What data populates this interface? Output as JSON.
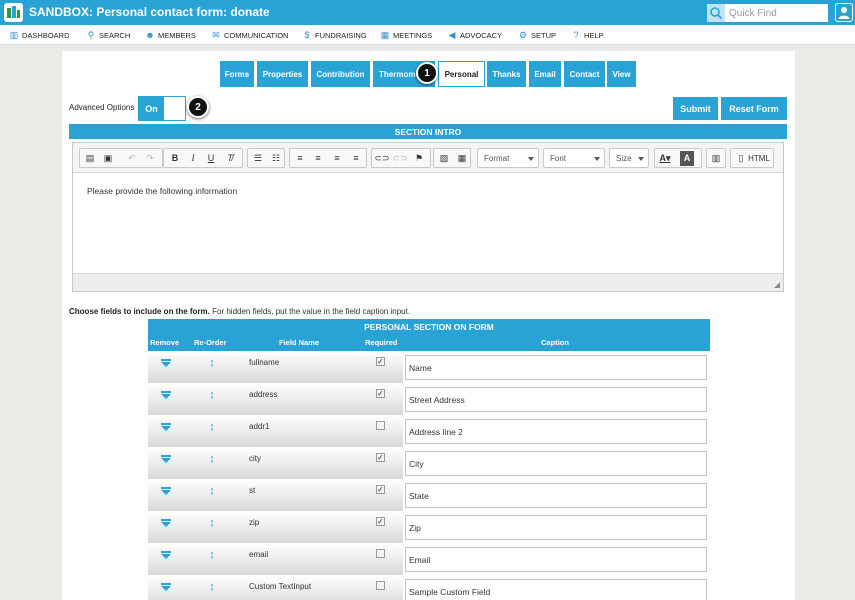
{
  "app": {
    "title": "SANDBOX: Personal contact form: donate"
  },
  "search": {
    "placeholder": "Quick Find",
    "icon": "search-icon"
  },
  "nav": [
    {
      "label": "DASHBOARD",
      "icon": "dashboard-icon",
      "glyph": "▥"
    },
    {
      "label": "SEARCH",
      "icon": "search-icon",
      "glyph": "⚲"
    },
    {
      "label": "MEMBERS",
      "icon": "members-icon",
      "glyph": "☻"
    },
    {
      "label": "COMMUNICATION",
      "icon": "envelope-icon",
      "glyph": "✉"
    },
    {
      "label": "FUNDRAISING",
      "icon": "dollar-icon",
      "glyph": "$"
    },
    {
      "label": "MEETINGS",
      "icon": "calendar-icon",
      "glyph": "▦"
    },
    {
      "label": "ADVOCACY",
      "icon": "megaphone-icon",
      "glyph": "◀"
    },
    {
      "label": "SETUP",
      "icon": "gear-icon",
      "glyph": "⚙"
    },
    {
      "label": "HELP",
      "icon": "help-icon",
      "glyph": "?"
    }
  ],
  "tabs": [
    "Forms",
    "Properties",
    "Contribution",
    "Thermom",
    "Personal",
    "Thanks",
    "Email",
    "Contact",
    "View"
  ],
  "active_tab": "Personal",
  "callouts": [
    "1",
    "2"
  ],
  "advanced": {
    "label": "Advanced Options",
    "state": "On"
  },
  "buttons": {
    "submit": "Submit",
    "reset": "Reset Form"
  },
  "section_intro": {
    "title": "SECTION INTRO"
  },
  "editor": {
    "combos": {
      "format": "Format",
      "font": "Font",
      "size": "Size"
    },
    "html_label": "HTML",
    "content": "Please provide the following information"
  },
  "choose": {
    "bold": "Choose fields to include on the form.",
    "rest": " For hidden fields, put the value in the field caption input."
  },
  "grid": {
    "title": "PERSONAL SECTION ON FORM",
    "headers": {
      "remove": "Remove",
      "reorder": "Re-Order",
      "field": "Field Name",
      "required": "Required",
      "caption": "Caption"
    },
    "rows": [
      {
        "field": "fullname",
        "required": true,
        "caption": "Name"
      },
      {
        "field": "address",
        "required": true,
        "caption": "Street Address"
      },
      {
        "field": "addr1",
        "required": false,
        "caption": "Address line 2"
      },
      {
        "field": "city",
        "required": true,
        "caption": "City"
      },
      {
        "field": "st",
        "required": true,
        "caption": "State"
      },
      {
        "field": "zip",
        "required": true,
        "caption": "Zip"
      },
      {
        "field": "email",
        "required": false,
        "caption": "Email"
      },
      {
        "field": "Custom TextInput",
        "required": false,
        "caption": "Sample Custom Field"
      }
    ]
  },
  "colors": {
    "accent": "#29a3d6",
    "page_bg": "#e9ece6"
  }
}
